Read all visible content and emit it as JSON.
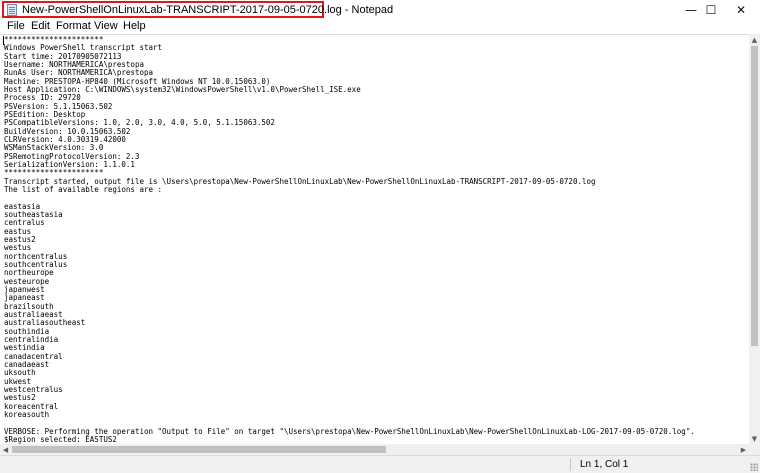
{
  "window": {
    "title": "New-PowerShellOnLinuxLab-TRANSCRIPT-2017-09-05-0720.log - Notepad",
    "controls": {
      "minimize": "—",
      "maximize": "☐",
      "close": "✕"
    }
  },
  "menu": [
    "File",
    "Edit",
    "Format",
    "View",
    "Help"
  ],
  "content_lines": [
    "**********************",
    "Windows PowerShell transcript start",
    "Start time: 20170905072113",
    "Username: NORTHAMERICA\\prestopa",
    "RunAs User: NORTHAMERICA\\prestopa",
    "Machine: PRESTOPA-HP840 (Microsoft Windows NT 10.0.15063.0)",
    "Host Application: C:\\WINDOWS\\system32\\WindowsPowerShell\\v1.0\\PowerShell_ISE.exe",
    "Process ID: 29720",
    "PSVersion: 5.1.15063.502",
    "PSEdition: Desktop",
    "PSCompatibleVersions: 1.0, 2.0, 3.0, 4.0, 5.0, 5.1.15063.502",
    "BuildVersion: 10.0.15063.502",
    "CLRVersion: 4.0.30319.42000",
    "WSManStackVersion: 3.0",
    "PSRemotingProtocolVersion: 2.3",
    "SerializationVersion: 1.1.0.1",
    "**********************",
    "Transcript started, output file is \\Users\\prestopa\\New-PowerShellOnLinuxLab\\New-PowerShellOnLinuxLab-TRANSCRIPT-2017-09-05-0720.log",
    "The list of available regions are :",
    "",
    "eastasia",
    "southeastasia",
    "centralus",
    "eastus",
    "eastus2",
    "westus",
    "northcentralus",
    "southcentralus",
    "northeurope",
    "westeurope",
    "japanwest",
    "japaneast",
    "brazilsouth",
    "australiaeast",
    "australiasoutheast",
    "southindia",
    "centralindia",
    "westindia",
    "canadacentral",
    "canadaeast",
    "uksouth",
    "ukwest",
    "westcentralus",
    "westus2",
    "koreacentral",
    "koreasouth",
    "",
    "VERBOSE: Performing the operation \"Output to File\" on target \"\\Users\\prestopa\\New-PowerShellOnLinuxLab\\New-PowerShellOnLinuxLab-LOG-2017-09-05-0720.log\".",
    "$Region selected: EASTUS2"
  ],
  "status": {
    "position": "Ln 1, Col 1"
  },
  "colors": {
    "highlight_border": "#e0181e",
    "chrome": "#f0f0f0",
    "scroll_thumb": "#c1c1c1"
  },
  "icons": {
    "app": "notepad-icon",
    "scroll_up": "▲",
    "scroll_down": "▼",
    "scroll_left": "◀",
    "scroll_right": "▶"
  }
}
